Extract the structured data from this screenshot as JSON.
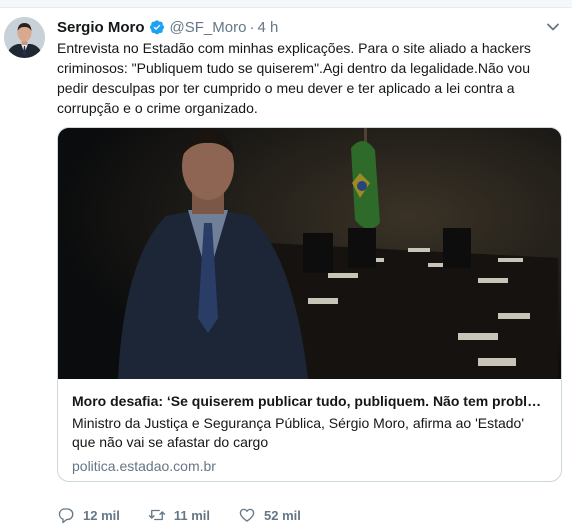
{
  "tweet": {
    "author_name": "Sergio Moro",
    "handle": "@SF_Moro",
    "separator": "·",
    "time": "4 h",
    "text": "Entrevista no Estadão com minhas explicações. Para o site aliado a hackers criminosos: \"Publiquem tudo se quiserem\".Agi dentro da legalidade.Não vou pedir desculpas por ter cumprido o meu dever e ter aplicado a lei contra a corrupção e o crime organizado."
  },
  "card": {
    "title": "Moro desafia: ‘Se quiserem publicar tudo, publiquem. Não tem problema’",
    "description": "Ministro da Justiça e Segurança Pública, Sérgio Moro, afirma ao 'Estado' que não vai se afastar do cargo",
    "url": "politica.estadao.com.br"
  },
  "actions": {
    "replies": "12 mil",
    "retweets": "11 mil",
    "likes": "52 mil"
  },
  "colors": {
    "text": "#14171a",
    "secondary": "#657786",
    "verified": "#1da1f2",
    "card_border": "#ccd6dd"
  },
  "icons": [
    "verified-badge-icon",
    "chevron-down-icon",
    "reply-icon",
    "retweet-icon",
    "like-icon"
  ]
}
